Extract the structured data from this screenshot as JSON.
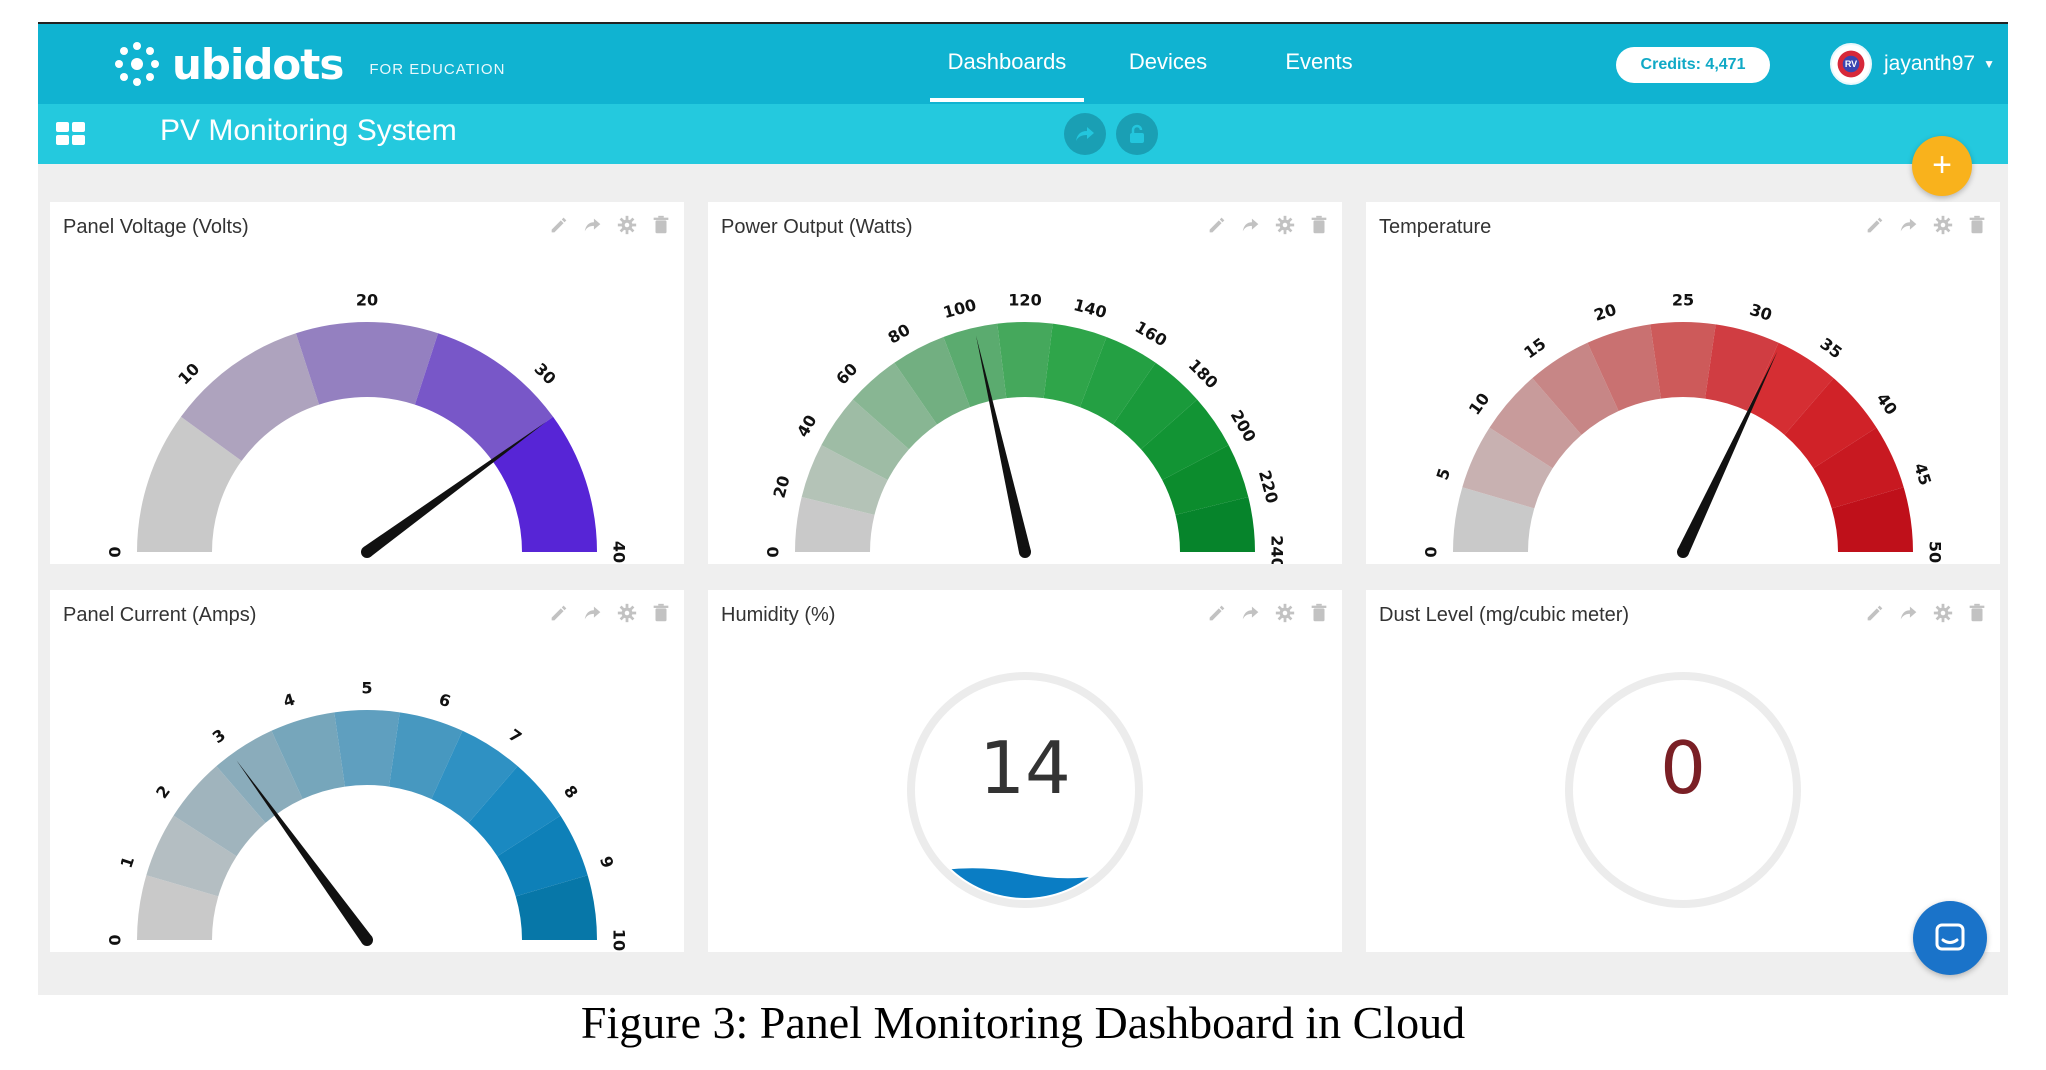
{
  "topbar": {
    "brand": "ubidots",
    "edition": "FOR EDUCATION",
    "nav": [
      "Dashboards",
      "Devices",
      "Events"
    ],
    "active_nav": "Dashboards",
    "credits": "Credits: 4,471",
    "username": "jayanth97",
    "avatar_text": "RV"
  },
  "subbar": {
    "dashboard_title": "PV Monitoring System",
    "icons": [
      "grid-icon",
      "share-icon",
      "lock-icon"
    ]
  },
  "fab_label": "+",
  "widgets": [
    {
      "title": "Panel Voltage (Volts)",
      "type": "gauge",
      "min": 0,
      "max": 40,
      "ticks": [
        "0",
        "10",
        "20",
        "30",
        "40"
      ],
      "value": 32,
      "colors": [
        "#c9c9c9",
        "#aea3be",
        "#9480c0",
        "#7857c8",
        "#5725d6"
      ]
    },
    {
      "title": "Power Output (Watts)",
      "type": "gauge",
      "min": 0,
      "max": 240,
      "ticks": [
        "0",
        "20",
        "40",
        "60",
        "80",
        "100",
        "120",
        "140",
        "160",
        "180",
        "200",
        "220",
        "240"
      ],
      "value": 103,
      "colors": [
        "#c9c9c9",
        "#b4c3b7",
        "#9ebca5",
        "#88b693",
        "#72af81",
        "#5bab6f",
        "#45a85c",
        "#2fa54a",
        "#24a043",
        "#1a9a3b",
        "#129434",
        "#0c8c2d",
        "#06842b"
      ]
    },
    {
      "title": "Temperature",
      "type": "gauge",
      "min": 0,
      "max": 50,
      "ticks": [
        "0",
        "5",
        "10",
        "15",
        "20",
        "25",
        "30",
        "35",
        "40",
        "45",
        "50"
      ],
      "value": 32,
      "colors": [
        "#c9c9c9",
        "#c8b1b1",
        "#c89b9b",
        "#c78686",
        "#c97171",
        "#cd5a5a",
        "#d03d42",
        "#d52e33",
        "#d02228",
        "#c81921",
        "#bf101a"
      ]
    },
    {
      "title": "Panel Current (Amps)",
      "type": "gauge",
      "min": 0,
      "max": 10,
      "ticks": [
        "0",
        "1",
        "2",
        "3",
        "4",
        "5",
        "6",
        "7",
        "8",
        "9",
        "10"
      ],
      "value": 3,
      "colors": [
        "#c9c9c9",
        "#b4bec2",
        "#a0b4bd",
        "#8aacbb",
        "#76a6bb",
        "#5f9fbf",
        "#4798c0",
        "#2f91c3",
        "#1a89c1",
        "#0e80b8",
        "#0777a8"
      ]
    },
    {
      "title": "Humidity (%)",
      "type": "indicator",
      "value": "14",
      "value_color": "#333333",
      "fill_color": "#0a7dc4",
      "fill_level": 0.14
    },
    {
      "title": "Dust Level (mg/cubic meter)",
      "type": "indicator",
      "value": "0",
      "value_color": "#7a1f25",
      "fill_color": "#0a7dc4",
      "fill_level": 0.0
    }
  ],
  "widget_tools": [
    "edit-icon",
    "share-icon",
    "settings-icon",
    "delete-icon"
  ],
  "caption": "Figure 3: Panel Monitoring Dashboard in Cloud"
}
